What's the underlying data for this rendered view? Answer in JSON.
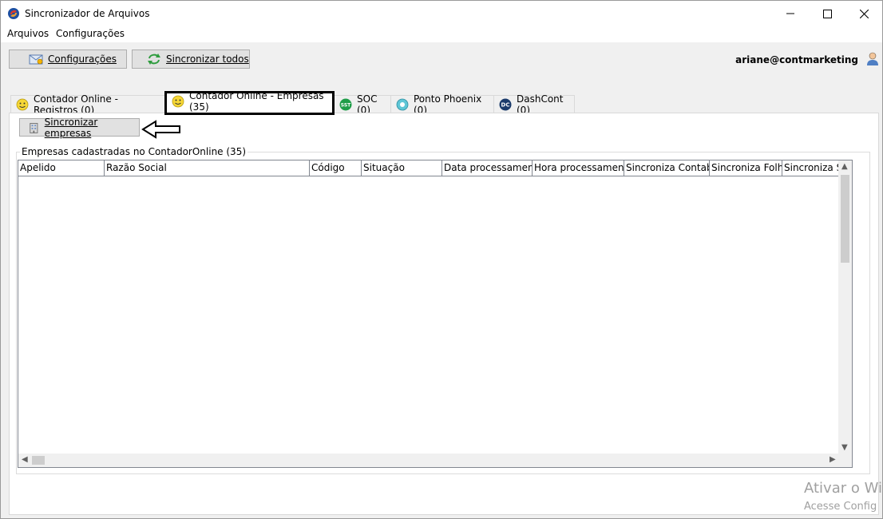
{
  "window": {
    "title": "Sincronizador de Arquivos"
  },
  "menu": {
    "items": [
      "Arquivos",
      "Configurações"
    ]
  },
  "toolbar": {
    "config_label": "Configurações",
    "sync_all_label": "Sincronizar todos",
    "user": "ariane@contmarketing"
  },
  "tabs": [
    {
      "label": "Contador Online - Registros (0)",
      "icon": "smiley-icon"
    },
    {
      "label": "Contador Online - Empresas (35)",
      "icon": "smiley-icon",
      "active": true
    },
    {
      "label": "SOC (0)",
      "icon": "sst-icon"
    },
    {
      "label": "Ponto Phoenix (0)",
      "icon": "phoenix-icon"
    },
    {
      "label": "DashCont (0)",
      "icon": "dc-icon"
    }
  ],
  "panel": {
    "sync_button": "Sincronizar empresas",
    "group_label": "Empresas cadastradas no ContadorOnline (35)",
    "columns": [
      "Apelido",
      "Razão Social",
      "Código",
      "Situação",
      "Data processamento",
      "Hora processamento",
      "Sincroniza Contabil",
      "Sincroniza Folha",
      "Sincroniza SS"
    ],
    "rows": []
  },
  "watermark": {
    "line1": "Ativar o Wi",
    "line2": "Acesse Config"
  },
  "colors": {
    "accent_border": "#000000",
    "toolbar_bg": "#f0f0f0"
  }
}
